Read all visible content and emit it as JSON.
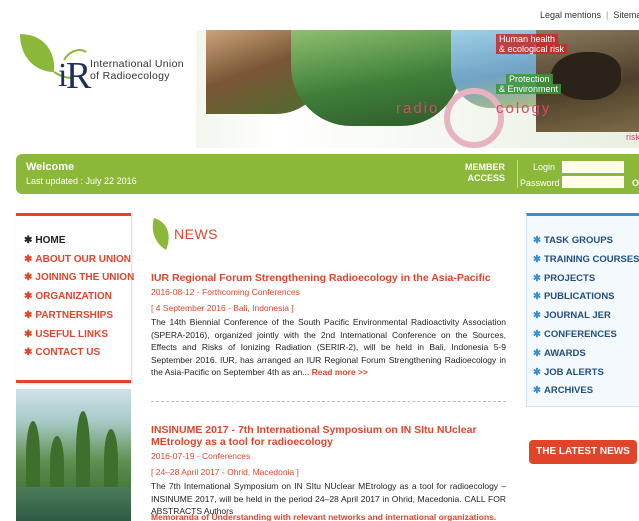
{
  "top_links": {
    "legal": "Legal mentions",
    "sitemap": "Sitemap"
  },
  "logo": {
    "line1": "International Union",
    "line2": "of Radioecology"
  },
  "banner": {
    "label_health1": "Human health",
    "label_health2": "& ecological risk",
    "label_protect1": "Protection",
    "label_protect2": "& Environment",
    "word_radio": "radio",
    "word_ecology": "cology",
    "word_risk": "risk"
  },
  "greenbar": {
    "welcome": "Welcome",
    "updated": "Last updated : July 22 2016",
    "member_line1": "MEMBER",
    "member_line2": "ACCESS",
    "login_label": "Login",
    "password_label": "Password",
    "login_value": "",
    "password_value": "",
    "ok": "Ok"
  },
  "left_menu": {
    "items": [
      {
        "label": "HOME"
      },
      {
        "label": "ABOUT OUR UNION"
      },
      {
        "label": "JOINING THE UNION"
      },
      {
        "label": "ORGANIZATION"
      },
      {
        "label": "PARTNERSHIPS"
      },
      {
        "label": "USEFUL LINKS"
      },
      {
        "label": "CONTACT US"
      }
    ]
  },
  "news": {
    "heading": "NEWS",
    "articles": [
      {
        "title": "IUR Regional Forum Strengthening Radioecology in the Asia-Pacific",
        "meta": "2016-08-12 - Forthcoming Conferences",
        "place": "[ 4 September 2016 - Bali, Indonesia ]",
        "body": "The 14th Biennial Conference of the South Pacific Environmental Radioactivity Association (SPERA-2016), organized jointly with the 2nd International Conference on the Sources, Effects and Risks of Ionizing Radiation (SERIR-2), will be held in Bali, Indonesia 5-9 September 2016. IUR, has arranged an IUR Regional Forum Strengthening Radioecology in the Asia-Pacific on September 4th as an...",
        "more": "Read more >>"
      },
      {
        "title": "INSINUME 2017 - 7th International Symposium on IN SItu NUclear MEtrology as a tool for radioecology",
        "meta": "2016-07-19 - Conferences",
        "place": "[ 24–28 April 2017 - Ohrid, Macedonia ]",
        "body": "The 7th International Symposium on IN SItu NUclear MEtrology as a tool for radioecology – INSINUME 2017, will be held in the period 24–28 April 2017 in Ohrid, Macedonia. CALL FOR ABSTRACTS Authors",
        "overlay": "Memoranda of Understanding with relevant networks and international organizations."
      }
    ]
  },
  "right_menu": {
    "items": [
      {
        "label": "TASK GROUPS"
      },
      {
        "label": "TRAINING COURSES"
      },
      {
        "label": "PROJECTS"
      },
      {
        "label": "PUBLICATIONS"
      },
      {
        "label": "JOURNAL JER"
      },
      {
        "label": "CONFERENCES"
      },
      {
        "label": "AWARDS"
      },
      {
        "label": "JOB ALERTS"
      },
      {
        "label": "ARCHIVES"
      }
    ]
  },
  "latest_news": {
    "label": "THE LATEST NEWS"
  },
  "colors": {
    "accent_red": "#e0452a",
    "green_bar": "#8cb83a",
    "blue_accent": "#3a8fd0",
    "menu_blue_text": "#1f4f80"
  }
}
